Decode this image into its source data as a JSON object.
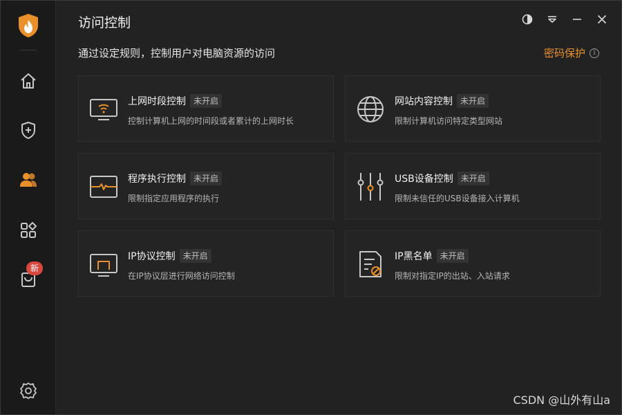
{
  "header": {
    "title": "访问控制",
    "subtitle": "通过设定规则，控制用户对电脑资源的访问",
    "password_protect_label": "密码保护",
    "info_glyph": "i"
  },
  "sidebar": {
    "items": [
      {
        "name": "home-icon"
      },
      {
        "name": "shield-plus-icon"
      },
      {
        "name": "user-group-icon",
        "active": true
      },
      {
        "name": "apps-icon"
      },
      {
        "name": "toolbox-icon",
        "badge": "新"
      },
      {
        "name": "settings-icon"
      }
    ],
    "accent_color": "#e9902a"
  },
  "cards": [
    {
      "title": "上网时段控制",
      "status": "未开启",
      "desc": "控制计算机上网的时间段或者累计的上网时长"
    },
    {
      "title": "网站内容控制",
      "status": "未开启",
      "desc": "限制计算机访问特定类型网站"
    },
    {
      "title": "程序执行控制",
      "status": "未开启",
      "desc": "限制指定应用程序的执行"
    },
    {
      "title": "USB设备控制",
      "status": "未开启",
      "desc": "限制未信任的USB设备接入计算机"
    },
    {
      "title": "IP协议控制",
      "status": "未开启",
      "desc": "在IP协议层进行网络访问控制"
    },
    {
      "title": "IP黑名单",
      "status": "未开启",
      "desc": "限制对指定IP的出站、入站请求"
    }
  ],
  "watermark": "CSDN @山外有山a"
}
